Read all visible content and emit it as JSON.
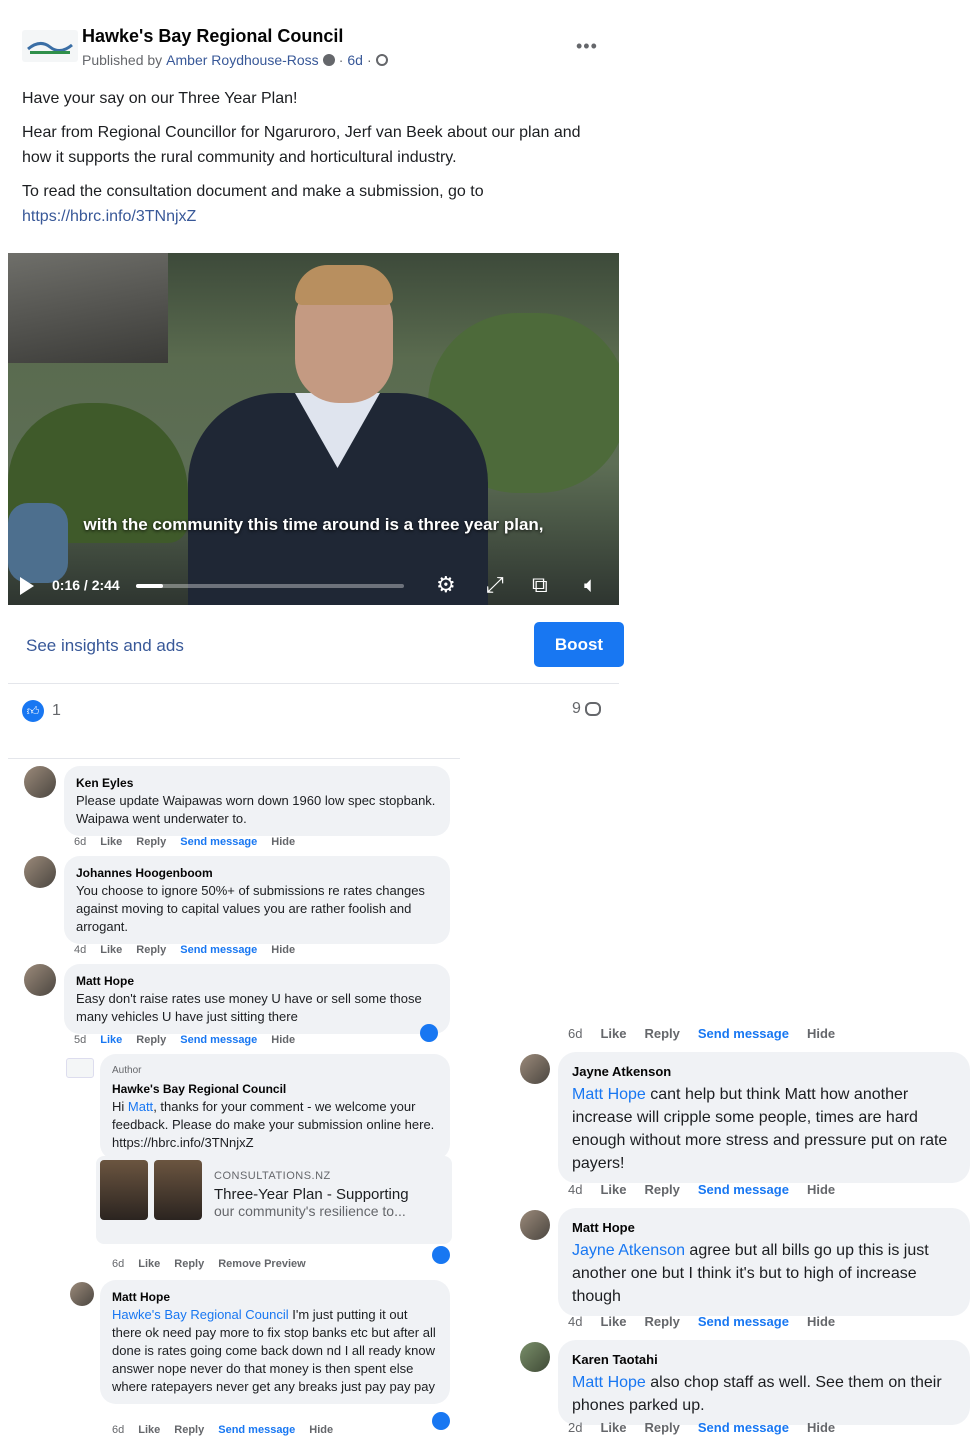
{
  "post": {
    "page_name": "Hawke's Bay Regional Council",
    "published_by_prefix": "Published by",
    "author": "Amber Roydhouse-Ross",
    "age": "6d",
    "more_label": "•••",
    "text": {
      "line1": "Have your say on our Three Year Plan!",
      "line2": "Hear from Regional Councillor for Ngaruroro, Jerf van Beek about our plan and how it supports the rural community and horticultural industry.",
      "line3": "To read the consultation document and make a submission, go to",
      "link": "https://hbrc.info/3TNnjxZ"
    },
    "video": {
      "caption": "with the community this time around is a three year plan,",
      "time": "0:16 / 2:44",
      "progress": 0.1
    },
    "insights_label": "See insights and ads",
    "boost_label": "Boost",
    "reaction_count": "1",
    "comment_count": "9"
  },
  "comments": [
    {
      "name": "Ken Eyles",
      "text": "Please update Waipawas worn down 1960 low spec stopbank. Waipawa went underwater to.",
      "age": "6d"
    },
    {
      "name": "Johannes Hoogenboom",
      "text": "You choose to ignore 50%+ of submissions re rates changes against moving to capital values you are rather foolish and arrogant.",
      "age": "4d"
    },
    {
      "name": "Matt Hope",
      "text": "Easy don't raise rates use money U have or sell some those many vehicles U have just sitting there",
      "age": "5d"
    }
  ],
  "reply_hbrc": {
    "badge": "Author",
    "name": "Hawke's Bay Regional Council",
    "text_pre": "Hi ",
    "mention": "Matt",
    "text_post": ", thanks for your comment - we welcome your feedback. Please do make your submission online here. https://hbrc.info/3TNnjxZ",
    "age": "6d",
    "remove_label": "Remove Preview"
  },
  "preview": {
    "source": "CONSULTATIONS.NZ",
    "title": "Three-Year Plan - Supporting",
    "desc": "our community's resilience to..."
  },
  "reply_matt": {
    "name": "Matt Hope",
    "mention": "Hawke's Bay Regional Council",
    "text": " I'm just putting it out there ok need pay more to fix stop banks etc but after all done is rates going come back down nd I all ready know answer nope never do that money is then spent else where ratepayers never get any breaks just pay pay pay",
    "age": "6d"
  },
  "right_top_age": "6d",
  "right_comments": [
    {
      "name": "Jayne Atkenson",
      "mention": "Matt Hope",
      "text": " cant help but think Matt how another increase will cripple some people, times are hard enough without more stress and pressure put on rate payers!",
      "age": "4d"
    },
    {
      "name": "Matt Hope",
      "mention": "Jayne Atkenson",
      "text": " agree but all bills go up this is just another one but I think it's but to high of increase though",
      "age": "4d"
    },
    {
      "name": "Karen Taotahi",
      "mention": "Matt Hope",
      "text": " also chop staff as well. See them on their phones parked up.",
      "age": "2d"
    }
  ],
  "actions": {
    "like": "Like",
    "reply": "Reply",
    "send": "Send message",
    "hide": "Hide"
  },
  "colors": {
    "accent": "#1877f2",
    "link": "#385898",
    "bubble": "#f0f2f5"
  }
}
